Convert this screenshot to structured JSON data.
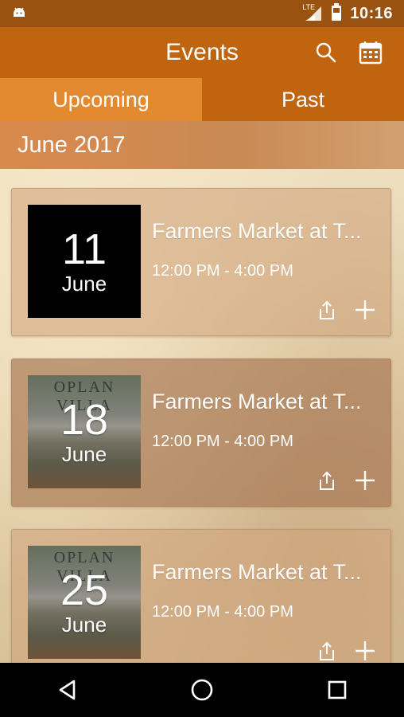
{
  "status_bar": {
    "time": "10:16",
    "network_label": "LTE",
    "icons": [
      "android-icon",
      "signal-icon",
      "battery-icon"
    ]
  },
  "app_bar": {
    "title": "Events",
    "actions": [
      "search-icon",
      "calendar-icon"
    ]
  },
  "tabs": [
    {
      "label": "Upcoming",
      "active": true
    },
    {
      "label": "Past",
      "active": false
    }
  ],
  "month_header": "June 2017",
  "events": [
    {
      "day": "11",
      "month": "June",
      "title": "Farmers Market at T...",
      "time": "12:00 PM - 4:00 PM",
      "thumb": "black"
    },
    {
      "day": "18",
      "month": "June",
      "title": "Farmers Market at T...",
      "time": "12:00 PM - 4:00 PM",
      "thumb": "photo",
      "photo_text": "OPLAN VILLA"
    },
    {
      "day": "25",
      "month": "June",
      "title": "Farmers Market at T...",
      "time": "12:00 PM - 4:00 PM",
      "thumb": "photo",
      "photo_text": "OPLAN VILLA"
    }
  ],
  "colors": {
    "status_bar": "#9a5210",
    "app_bar": "#c0640f",
    "active_tab": "#e38a30"
  },
  "nav_bar": [
    "back-icon",
    "home-icon",
    "recents-icon"
  ]
}
